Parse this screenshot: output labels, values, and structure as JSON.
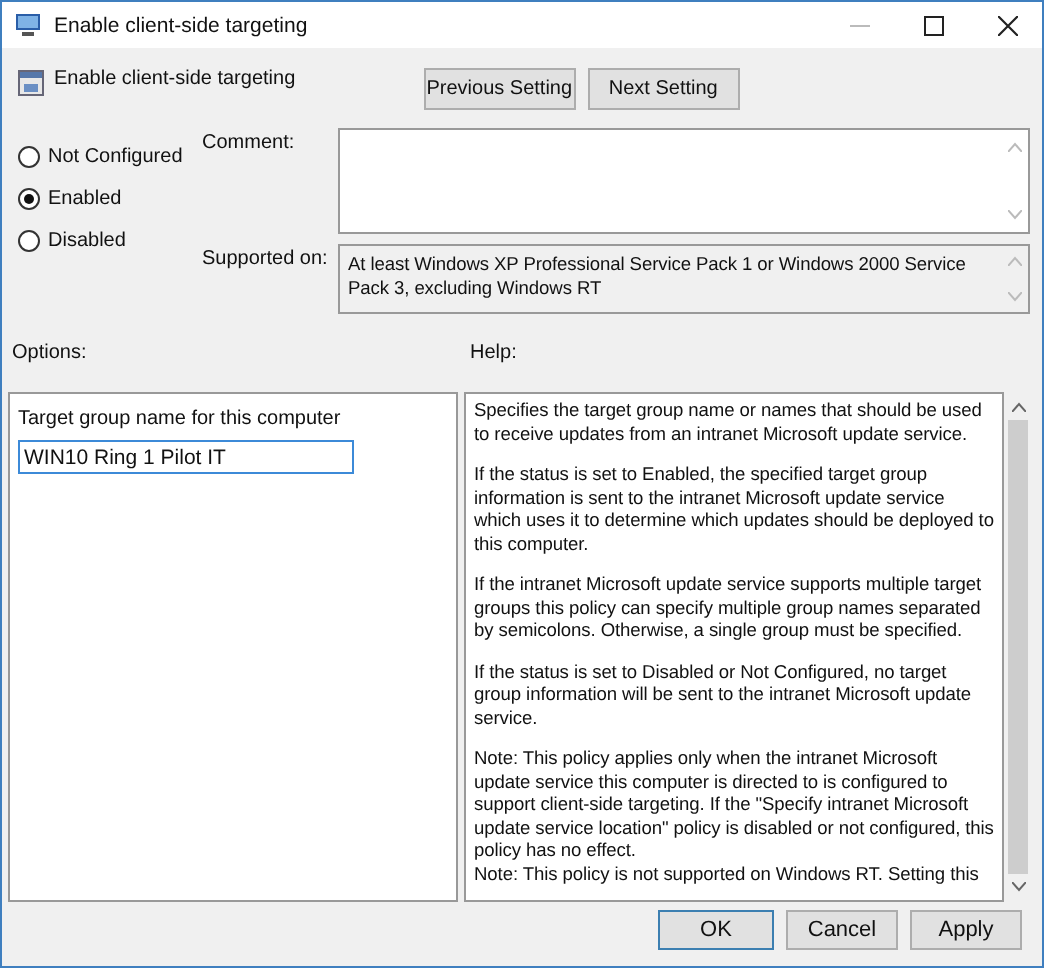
{
  "window": {
    "title": "Enable client-side targeting"
  },
  "header": {
    "title": "Enable client-side targeting"
  },
  "nav_buttons": [
    "Previous Setting",
    "Next Setting"
  ],
  "state_options": [
    {
      "label": "Not Configured",
      "selected": false
    },
    {
      "label": "Enabled",
      "selected": true
    },
    {
      "label": "Disabled",
      "selected": false
    }
  ],
  "comment": {
    "label": "Comment:"
  },
  "supported_on": {
    "label": "Supported on:",
    "value": "At least Windows XP Professional Service Pack 1 or Windows 2000 Service Pack 3, excluding Windows RT"
  },
  "options": {
    "label": "Options:",
    "field_label": "Target group name for this computer",
    "value": "WIN10 Ring 1 Pilot IT"
  },
  "help": {
    "label": "Help:",
    "paragraphs": [
      "Specifies the target group name or names that should be used to receive updates from an intranet Microsoft update service.",
      "If the status is set to Enabled, the specified target group information is sent to the intranet Microsoft update service which uses it to determine which updates should be deployed to this computer.",
      "If the intranet Microsoft update service supports multiple target groups this policy can specify multiple group names separated by semicolons. Otherwise, a single group must be specified.",
      "If the status is set to Disabled or Not Configured, no target group information will be sent to the intranet Microsoft update service.",
      "Note: This policy applies only when the intranet Microsoft update service this computer is directed to is configured to support client-side targeting. If the \"Specify intranet Microsoft update service location\" policy is disabled or not configured, this policy has no effect.\nNote: This policy is not supported on Windows RT. Setting this"
    ]
  },
  "buttons": [
    {
      "label": "OK",
      "kind": "default"
    },
    {
      "label": "Cancel",
      "kind": "normal"
    },
    {
      "label": "Apply",
      "kind": "normal"
    }
  ]
}
